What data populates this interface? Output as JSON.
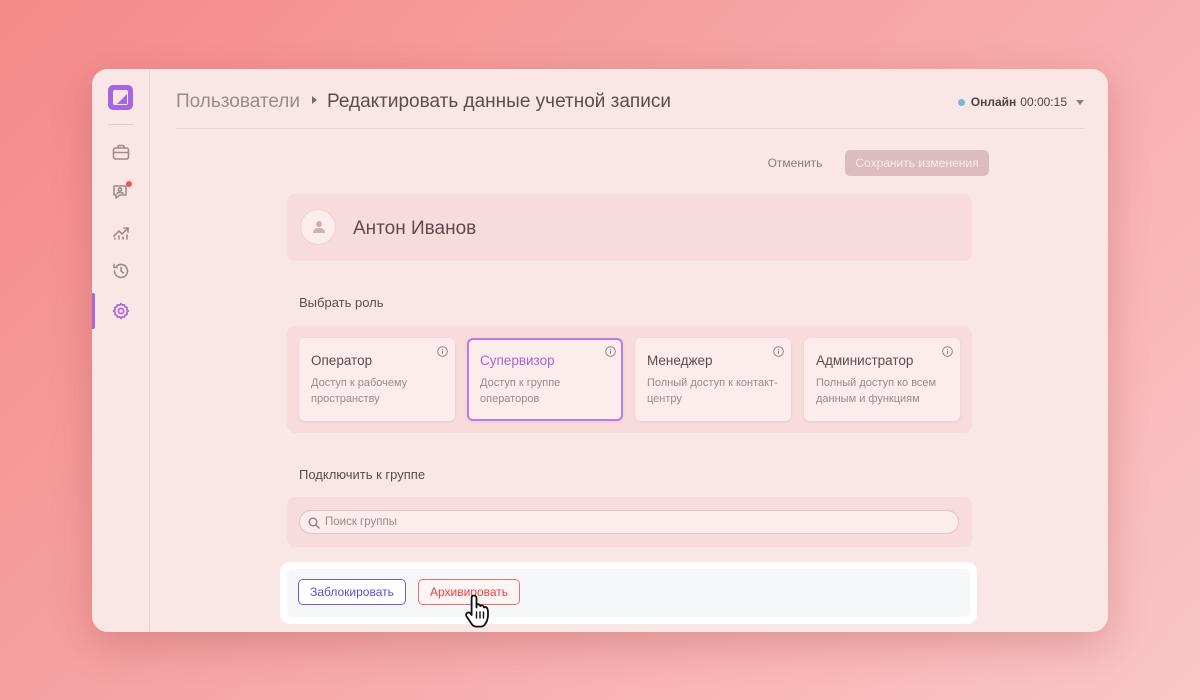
{
  "breadcrumb": {
    "root": "Пользователи",
    "current": "Редактировать данные учетной записи"
  },
  "status": {
    "label": "Онлайн",
    "timer": "00:00:15",
    "dot_color": "#7bb3e0"
  },
  "toolbar": {
    "cancel_label": "Отменить",
    "save_label": "Сохранить изменения"
  },
  "user": {
    "name": "Антон Иванов"
  },
  "roles": {
    "title": "Выбрать роль",
    "selected": "Супервизор",
    "items": [
      {
        "title": "Оператор",
        "description": "Доступ к рабочему пространству"
      },
      {
        "title": "Супервизор",
        "description": "Доступ к группе операторов"
      },
      {
        "title": "Менеджер",
        "description": "Полный доступ к контакт-центру"
      },
      {
        "title": "Администратор",
        "description": "Полный доступ ко всем данным и функциям"
      }
    ]
  },
  "groups": {
    "title": "Подключить к группе",
    "search_placeholder": "Поиск группы"
  },
  "actions": {
    "block_label": "Заблокировать",
    "archive_label": "Архивировать"
  },
  "sidebar": {
    "icons": [
      "briefcase-icon",
      "chat-agent-icon",
      "analytics-icon",
      "history-icon",
      "settings-icon"
    ],
    "active": "settings-icon"
  },
  "colors": {
    "accent": "#a765df",
    "danger": "#e04545",
    "primary_outline": "#5a4fc9"
  }
}
